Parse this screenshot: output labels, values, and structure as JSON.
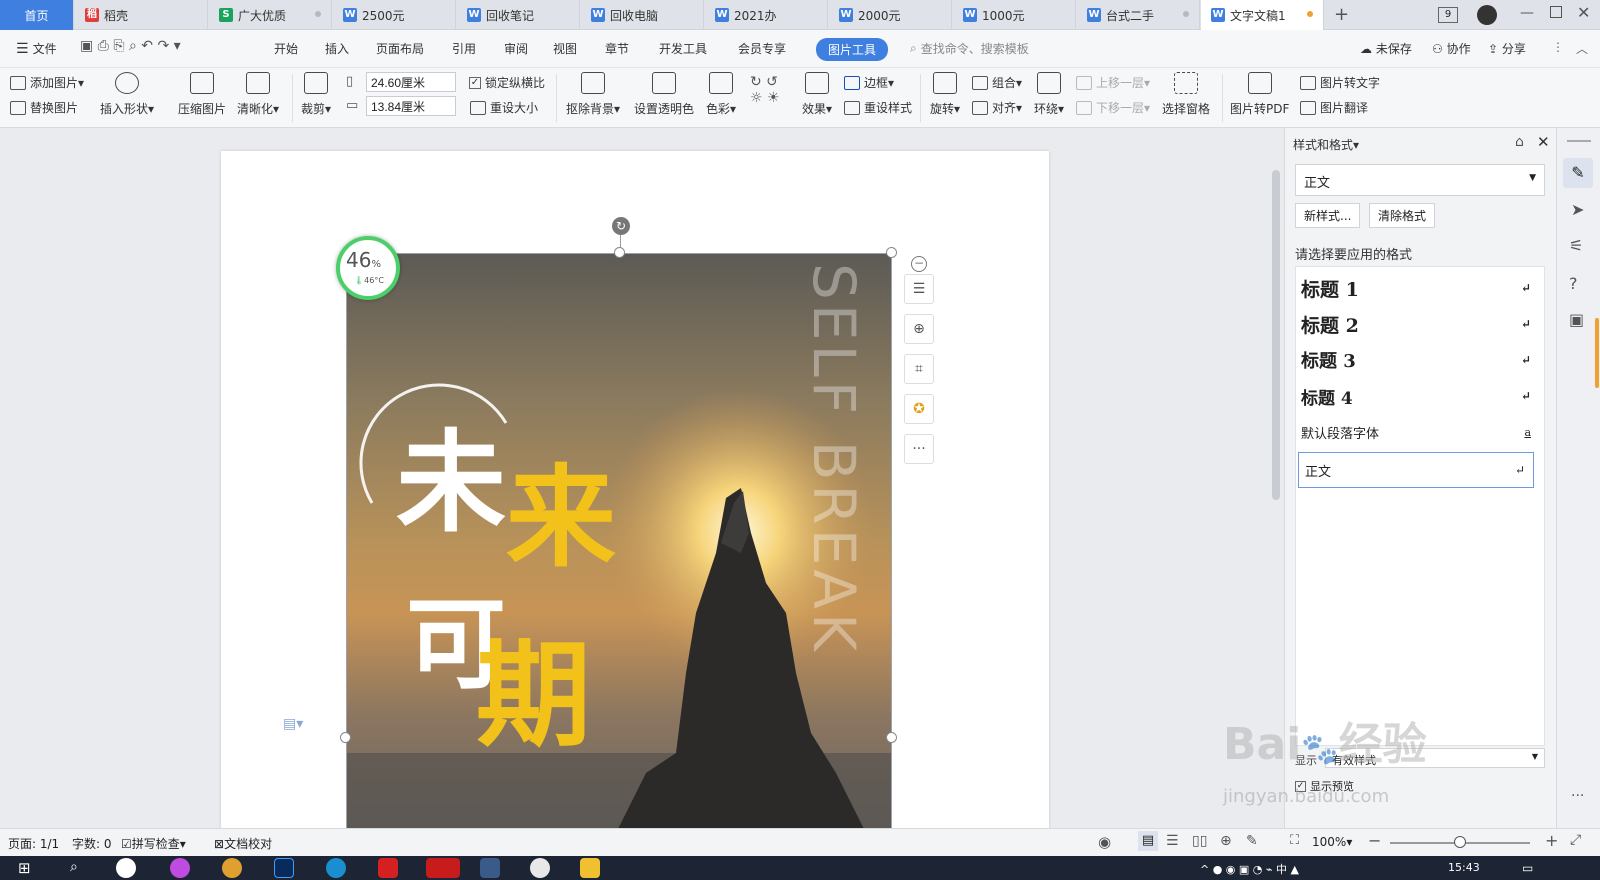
{
  "tabs": {
    "home": "首页",
    "items": [
      {
        "label": "稻壳",
        "icon": "daoke-icon",
        "color": "#e23d3d"
      },
      {
        "label": "广大优质",
        "icon": "spreadsheet-icon",
        "color": "#1aa35a"
      },
      {
        "label": "2500元",
        "icon": "writer-doc-icon",
        "color": "#3f7fe0"
      },
      {
        "label": "回收笔记",
        "icon": "writer-doc-icon",
        "color": "#3f7fe0"
      },
      {
        "label": "回收电脑",
        "icon": "writer-doc-icon",
        "color": "#3f7fe0"
      },
      {
        "label": "2021办",
        "icon": "writer-doc-icon",
        "color": "#3f7fe0"
      },
      {
        "label": "2000元",
        "icon": "writer-doc-icon",
        "color": "#3f7fe0"
      },
      {
        "label": "1000元",
        "icon": "writer-doc-icon",
        "color": "#3f7fe0"
      },
      {
        "label": "台式二手",
        "icon": "writer-doc-icon",
        "color": "#3f7fe0"
      },
      {
        "label": "文字文稿1",
        "icon": "writer-doc-icon",
        "color": "#3f7fe0"
      }
    ],
    "window_badge": "9"
  },
  "menu": {
    "file": "文件",
    "items": [
      "开始",
      "插入",
      "页面布局",
      "引用",
      "审阅",
      "视图",
      "章节",
      "开发工具",
      "会员专享"
    ],
    "active": "图片工具",
    "search_placeholder": "查找命令、搜索模板",
    "unsaved": "未保存",
    "collab": "协作",
    "share": "分享"
  },
  "ribbon": {
    "add_picture": "添加图片",
    "replace_picture": "替换图片",
    "insert_shape": "插入形状",
    "compress": "压缩图片",
    "sharpen": "清晰化",
    "crop": "裁剪",
    "width_value": "24.60厘米",
    "height_value": "13.84厘米",
    "lock_ratio": "锁定纵横比",
    "reset_size": "重设大小",
    "remove_bg": "抠除背景",
    "transparent": "设置透明色",
    "color": "色彩",
    "effects": "效果",
    "border": "边框",
    "reset_style": "重设样式",
    "rotate": "旋转",
    "group": "组合",
    "align": "对齐",
    "wrap": "环绕",
    "bring_forward": "上移一层",
    "send_backward": "下移一层",
    "selection_pane": "选择窗格",
    "to_pdf": "图片转PDF",
    "to_text": "图片转文字",
    "translate": "图片翻译"
  },
  "image": {
    "line1_a": "未",
    "line1_b": "来",
    "line2_a": "可",
    "line2_b": "期",
    "watermark": "SELF BREAK"
  },
  "cpu_widget": {
    "percent": "46",
    "unit": "%",
    "temp": "46°C"
  },
  "style_panel": {
    "title": "样式和格式",
    "current": "正文",
    "new_style": "新样式...",
    "clear_format": "清除格式",
    "prompt": "请选择要应用的格式",
    "styles": [
      "标题  1",
      "标题  2",
      "标题  3",
      "标题  4",
      "默认段落字体",
      "正文"
    ],
    "show_label": "显示",
    "show_value": "有效样式",
    "preview": "显示预览"
  },
  "status": {
    "page": "页面: 1/1",
    "words": "字数: 0",
    "spell": "拼写检查",
    "proof": "文档校对",
    "zoom": "100%",
    "zoom_fraction": 0.5
  },
  "taskbar": {
    "time": "15:43"
  },
  "watermark_site": {
    "brand": "Bai",
    "brand2": "经验",
    "url": "jingyan.baidu.com"
  }
}
